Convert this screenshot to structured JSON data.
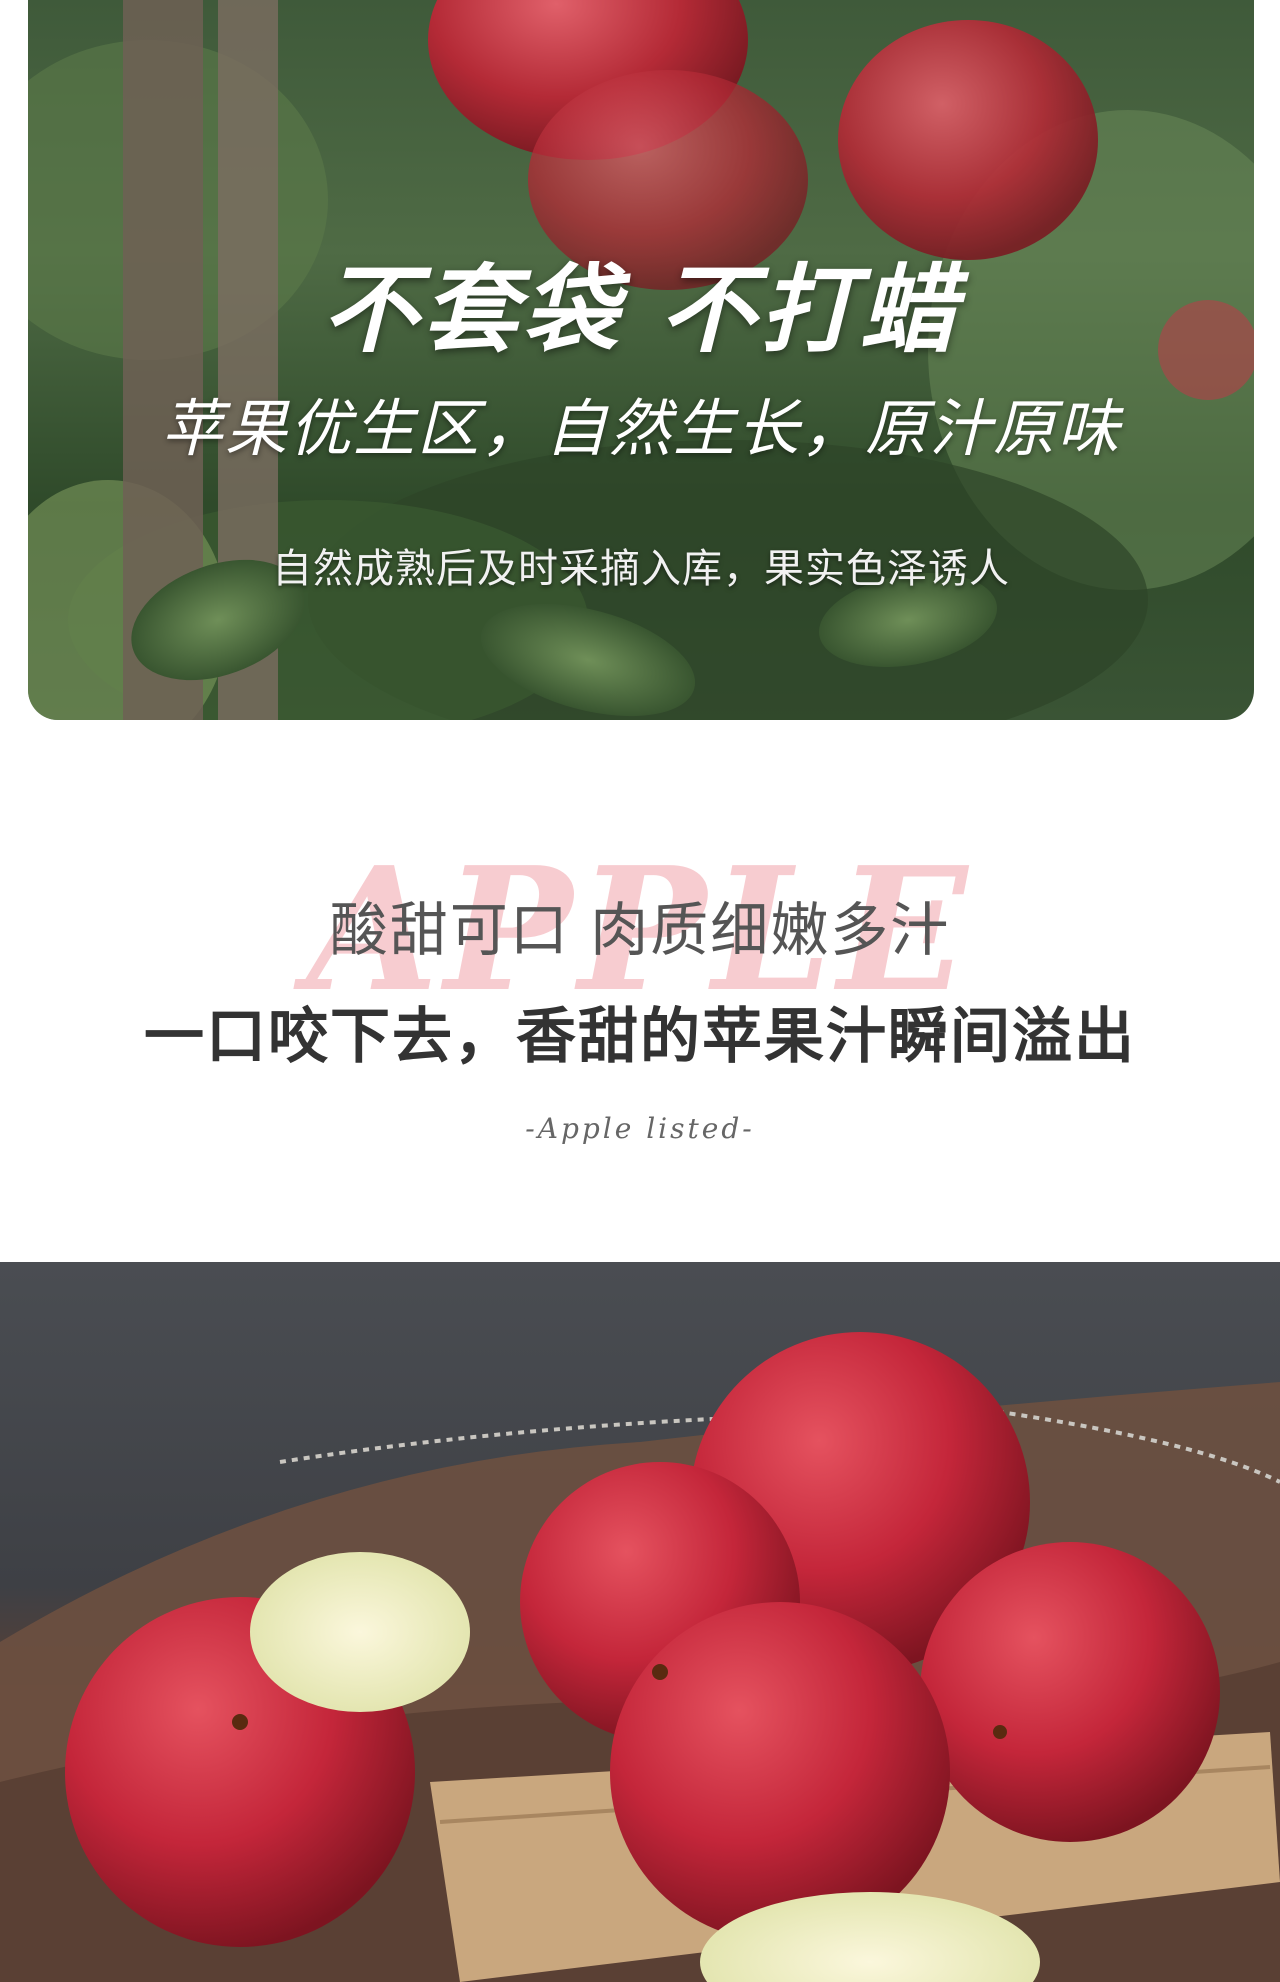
{
  "orchard_banner": {
    "headline": "不套袋 不打蜡",
    "subheadline": "苹果优生区，自然生长，原汁原味",
    "caption": "自然成熟后及时采摘入库，果实色泽诱人"
  },
  "taste_section": {
    "watermark": "APPLE",
    "tagline": "酸甜可口 肉质细嫩多汁",
    "headline": "一口咬下去，香甜的苹果汁瞬间溢出",
    "signature": "-Apple listed-"
  },
  "colors": {
    "apple_red": "#c4263a",
    "watermark_pink": "#f1a3aa"
  }
}
